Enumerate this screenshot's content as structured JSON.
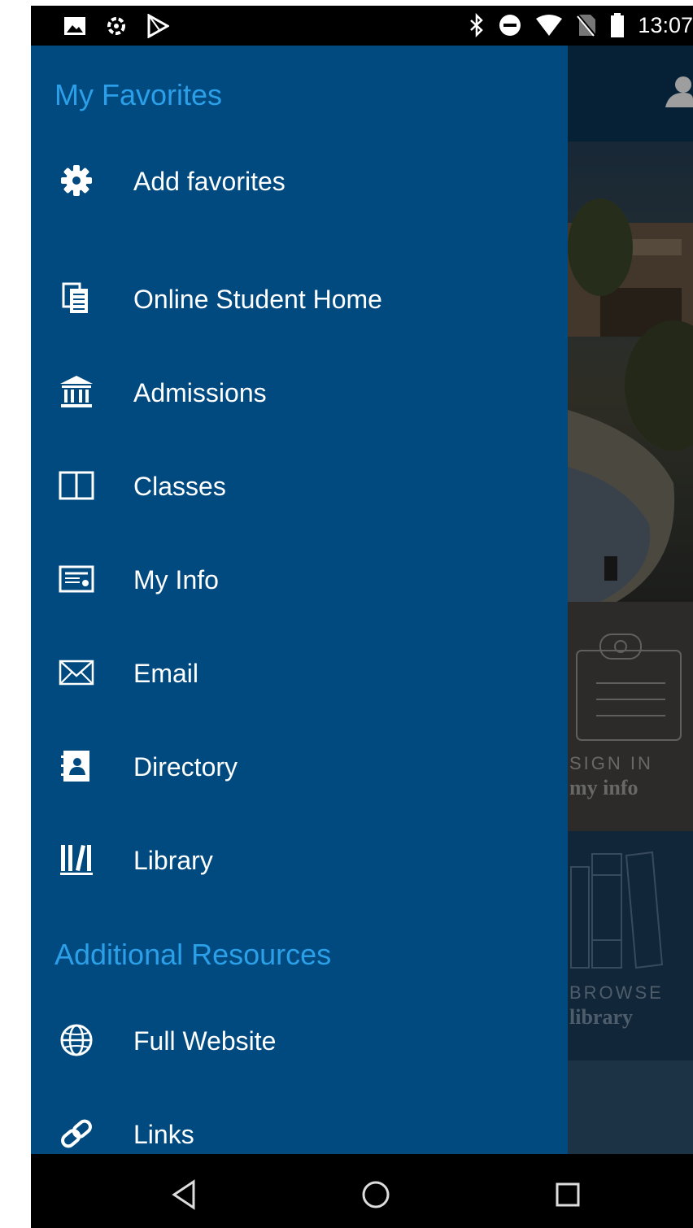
{
  "status_bar": {
    "time": "13:07"
  },
  "background": {
    "tiles": [
      {
        "line1": "SIGN IN",
        "line2": "my info"
      },
      {
        "line1": "BROWSE",
        "line2": "library"
      }
    ]
  },
  "drawer": {
    "favorites_title": "My Favorites",
    "favorites": [
      {
        "label": "Add favorites",
        "icon": "gear-icon"
      },
      {
        "label": "Online Student Home",
        "icon": "document-stack-icon"
      },
      {
        "label": "Admissions",
        "icon": "institution-icon"
      },
      {
        "label": "Classes",
        "icon": "book-icon"
      },
      {
        "label": "My Info",
        "icon": "id-card-icon"
      },
      {
        "label": "Email",
        "icon": "envelope-icon"
      },
      {
        "label": "Directory",
        "icon": "address-book-icon"
      },
      {
        "label": "Library",
        "icon": "library-icon"
      }
    ],
    "resources_title": "Additional Resources",
    "resources": [
      {
        "label": "Full Website",
        "icon": "globe-icon"
      },
      {
        "label": "Links",
        "icon": "link-icon"
      }
    ]
  },
  "colors": {
    "drawer_bg": "#004a80",
    "section_title": "#2b9fe8",
    "item_text": "#ffffff"
  }
}
